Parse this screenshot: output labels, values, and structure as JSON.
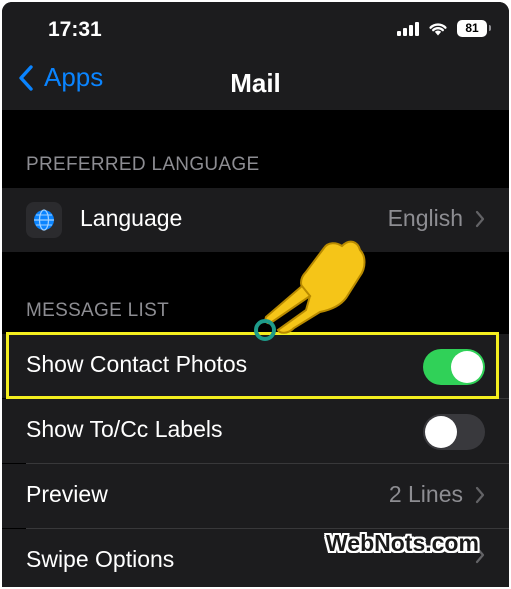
{
  "status_bar": {
    "time": "17:31",
    "battery_level": "81"
  },
  "nav": {
    "back_label": "Apps",
    "title": "Mail"
  },
  "sections": {
    "preferred_language": {
      "header": "PREFERRED LANGUAGE"
    },
    "message_list": {
      "header": "MESSAGE LIST"
    }
  },
  "rows": {
    "language": {
      "label": "Language",
      "value": "English",
      "icon": "globe-icon"
    },
    "show_contact_photos": {
      "label": "Show Contact Photos",
      "enabled": true
    },
    "show_to_cc_labels": {
      "label": "Show To/Cc Labels",
      "enabled": false
    },
    "preview": {
      "label": "Preview",
      "value": "2 Lines"
    },
    "swipe_options": {
      "label": "Swipe Options"
    }
  },
  "annotation": {
    "pointer": "pointing-hand-icon",
    "highlight_color": "#f4ee1f"
  },
  "watermark": "WebNots.com",
  "colors": {
    "accent": "#0a84ff",
    "toggle_on": "#30d158",
    "toggle_off": "#39393d"
  }
}
